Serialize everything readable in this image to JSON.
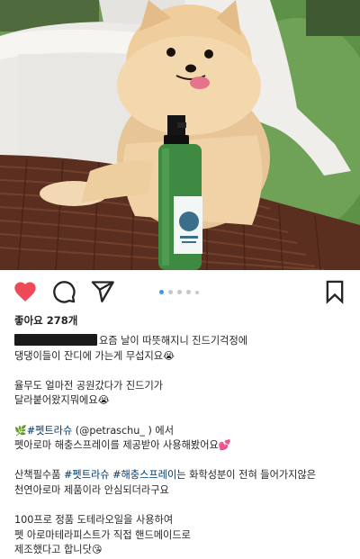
{
  "post": {
    "likes_label": "좋아요 278개",
    "caption_lines": [
      {
        "id": "l1",
        "text": "요즘 날이 따뜻해지니 진드기걱정에"
      },
      {
        "id": "l2",
        "text": "댕댕이들이 잔디에 가는게 무섭지요😭"
      },
      {
        "id": "l3",
        "text": "율무도 얼마전 공원갔다가 진드기가"
      },
      {
        "id": "l4",
        "text": "달라붙어왔지뭐에요😭"
      },
      {
        "id": "l5_emoji",
        "text": "🌿"
      },
      {
        "id": "l5_tag",
        "text": "#펫트라슈"
      },
      {
        "id": "l5_rest",
        "text": " (@petraschu_ ) 에서"
      },
      {
        "id": "l6",
        "text": "펫아로마 해충스프레이를 제공받아 사용해봤어요💕"
      },
      {
        "id": "l7_pre",
        "text": "산책필수품 "
      },
      {
        "id": "l7_tag1",
        "text": "#펫트라슈"
      },
      {
        "id": "l7_sp",
        "text": " "
      },
      {
        "id": "l7_tag2",
        "text": "#해충스프레이"
      },
      {
        "id": "l7_rest",
        "text": "는 화학성분이 전혀 들어가지않은"
      },
      {
        "id": "l8",
        "text": "천연아로마 제품이라 안심되더라구요"
      },
      {
        "id": "l9",
        "text": "100프로 정품 도테라오일을 사용하여"
      },
      {
        "id": "l10",
        "text": "펫 아로마테라피스트가 직접 핸드메이드로"
      },
      {
        "id": "l11",
        "text": "제조했다고 합니닷😘"
      }
    ]
  },
  "icons": {
    "like": "heart-filled-icon",
    "comment": "comment-bubble-icon",
    "share": "paper-plane-icon",
    "save": "bookmark-icon"
  },
  "carousel": {
    "count": 5,
    "active_index": 0
  },
  "colors": {
    "like_red": "#ed4956",
    "hashtag": "#00376b",
    "dot_active": "#3897f0"
  }
}
